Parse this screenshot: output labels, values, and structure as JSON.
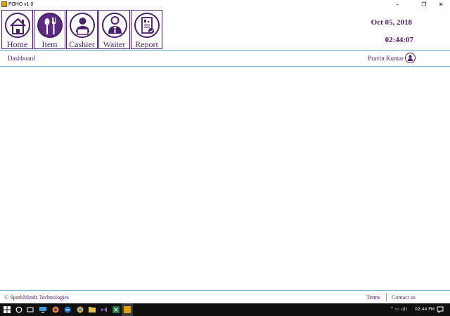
{
  "window": {
    "title": "FOHO v1.0",
    "controls": {
      "minimize": "–",
      "restore": "❐",
      "close": "✕"
    }
  },
  "toolbar": {
    "buttons": [
      {
        "label": "Home",
        "icon": "home-icon"
      },
      {
        "label": "Item",
        "icon": "fork-spoon-icon"
      },
      {
        "label": "Cashier",
        "icon": "cashier-icon"
      },
      {
        "label": "Waiter",
        "icon": "waiter-icon"
      },
      {
        "label": "Report",
        "icon": "report-icon"
      }
    ]
  },
  "header": {
    "date": "Oct 05, 2018",
    "time": "02:44:07"
  },
  "nav": {
    "breadcrumb": "Dashboard",
    "user_name": "Pravin Kumar"
  },
  "footer": {
    "copyright": "© SparkMindz Technologies",
    "terms": "Terms",
    "contact": "Contact us"
  },
  "taskbar": {
    "clock": "02:44 PM",
    "tray": "^ ▭ ◁))"
  },
  "colors": {
    "accent": "#4b1f6f",
    "accent_fill": "#5e2a85",
    "divider": "#5fb6c9",
    "taskbar": "#101010"
  }
}
